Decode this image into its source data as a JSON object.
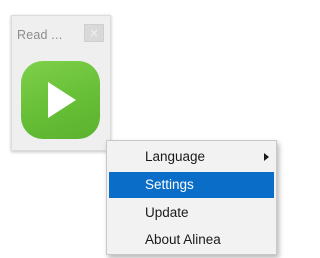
{
  "widget": {
    "title": "Read ...",
    "play_icon": "play-icon",
    "close_icon": "close-icon",
    "more_label": "...",
    "accent_color": "#6cc43a"
  },
  "context_menu": {
    "items": [
      {
        "label": "Language",
        "has_submenu": true,
        "selected": false
      },
      {
        "label": "Settings",
        "has_submenu": false,
        "selected": true
      },
      {
        "label": "Update",
        "has_submenu": false,
        "selected": false
      },
      {
        "label": "About Alinea",
        "has_submenu": false,
        "selected": false
      }
    ],
    "highlight_color": "#0a6ec8"
  }
}
